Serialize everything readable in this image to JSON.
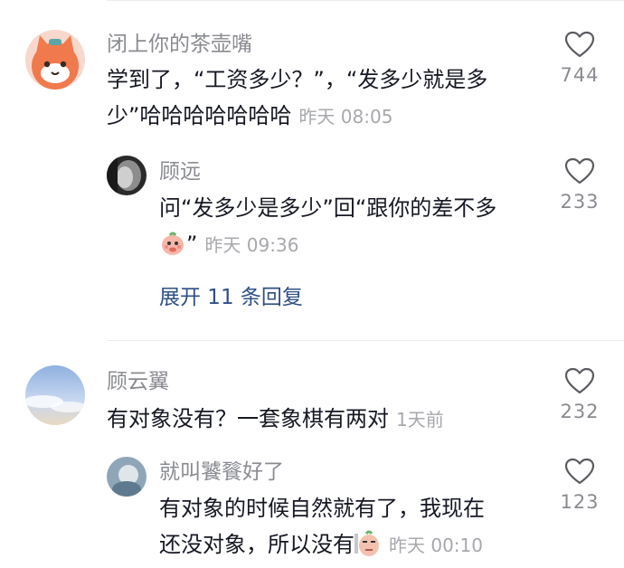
{
  "comments": [
    {
      "username": "闭上你的茶壶嘴",
      "text_line1": "学到了，“工资多少？”，“发多少就是多",
      "text_line2": "少”哈哈哈哈哈哈哈",
      "time": "昨天 08:05",
      "likes": "744",
      "reply": {
        "username": "顾远",
        "text_line1": "问“发多少是多少”回“跟你的差不多",
        "text_line2_suffix": "”",
        "time": "昨天 09:36",
        "likes": "233",
        "emoji": "peach-face-emoji"
      },
      "expand_label": "展开 11 条回复"
    },
    {
      "username": "顾云翼",
      "text_line1": "有对象没有？一套象棋有两对",
      "time": "1天前",
      "likes": "232",
      "reply": {
        "username": "就叫饕餮好了",
        "text_line1": "有对象的时候自然就有了，我现在",
        "text_line2": "还没对象，所以没有",
        "time": "昨天 00:10",
        "likes": "123",
        "emoji": "skeptical-peach-emoji"
      }
    }
  ],
  "icons": {
    "like": "heart-outline-icon"
  },
  "colors": {
    "username": "#8a8b91",
    "text": "#161823",
    "meta": "#a7a8ad",
    "expand": "#2f4f86",
    "divider": "#ececec"
  }
}
